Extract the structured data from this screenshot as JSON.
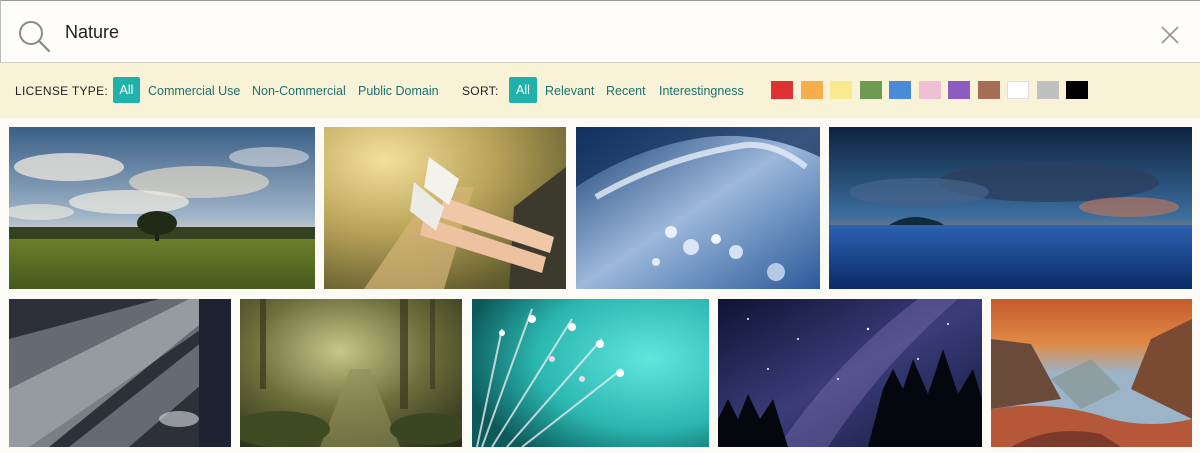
{
  "search": {
    "value": "Nature",
    "icon": "search-icon",
    "close_icon": "close-icon"
  },
  "filters": {
    "license_label": "LICENSE TYPE:",
    "license_options": [
      "All",
      "Commercial Use",
      "Non-Commercial",
      "Public Domain"
    ],
    "license_selected": "All",
    "sort_label": "SORT:",
    "sort_options": [
      "All",
      "Relevant",
      "Recent",
      "Interestingness"
    ],
    "sort_selected": "All",
    "color_swatches": [
      "#dd3333",
      "#f7ad4c",
      "#f9ea8f",
      "#6e9a52",
      "#4a8bd8",
      "#efbfd3",
      "#8d5cc0",
      "#a56d55",
      "#ffffff",
      "#c0c0c0",
      "#000000"
    ]
  },
  "colors": {
    "accent": "#20b2aa",
    "link": "#1f6f6f",
    "filter_bar_bg": "#f8f3d6"
  },
  "images": [
    "field-with-tree-under-clouds",
    "legs-in-white-sneakers-out-car-window",
    "water-splash-droplets",
    "ocean-sunset-with-island",
    "sunbeams-through-dark-forest",
    "mossy-forest-path",
    "dandelion-with-dew-drops",
    "milky-way-over-pine-trees",
    "red-rock-canyon"
  ]
}
